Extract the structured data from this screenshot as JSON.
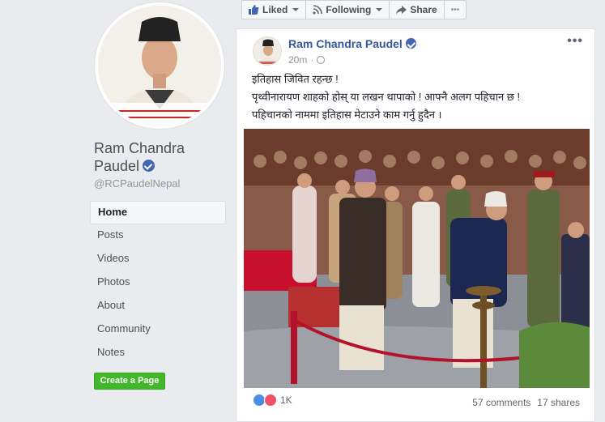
{
  "page": {
    "name": "Ram Chandra Paudel",
    "handle": "@RCPaudelNepal"
  },
  "nav": [
    {
      "label": "Home",
      "active": true
    },
    {
      "label": "Posts"
    },
    {
      "label": "Videos"
    },
    {
      "label": "Photos"
    },
    {
      "label": "About"
    },
    {
      "label": "Community"
    },
    {
      "label": "Notes"
    }
  ],
  "create_page_label": "Create a Page",
  "action_bar": {
    "liked_label": "Liked",
    "following_label": "Following",
    "share_label": "Share",
    "more_label": "•••"
  },
  "post": {
    "author": "Ram Chandra Paudel",
    "time": "20m",
    "more_label": "•••",
    "lines": [
      "इतिहास जिवित रहन्छ !",
      "पृथ्वीनारायण शाहको होस् या लखन थापाको ! आफ्नै अलग पहिचान छ !",
      "पहिचानको नाममा इतिहास मेटाउने काम गर्नु हुदैन ।"
    ],
    "reaction_count": "1K",
    "comments": "57 comments",
    "shares": "17 shares"
  },
  "colors": {
    "link": "#365899",
    "verified": "#4267b2",
    "create_button": "#42b72a",
    "like_reaction": "#4a90e2",
    "love_reaction": "#f25268"
  }
}
